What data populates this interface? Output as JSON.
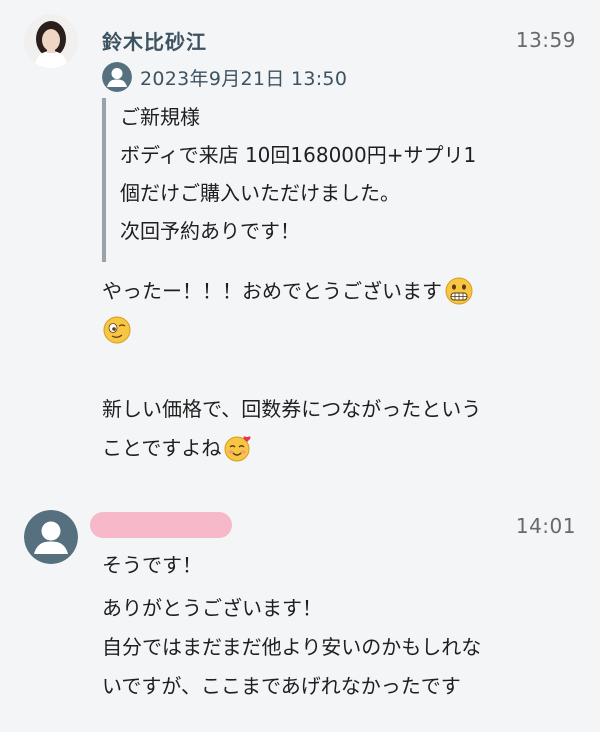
{
  "message1": {
    "sender": "鈴木比砂江",
    "time": "13:59",
    "avatar_icon": "profile-photo",
    "quote": {
      "icon": "default-user-icon",
      "timestamp": "2023年9月21日 13:50",
      "lines": [
        "ご新規様",
        "ボディで来店 10回168000円+サプリ1",
        "個だけご購入いただけました。",
        "次回予約ありです！"
      ]
    },
    "body": {
      "line1": "やったー！！！おめでとうございます",
      "line3": "新しい価格で、回数券につながったという",
      "line4": "ことですよね"
    },
    "emojis": [
      "grimacing-face-emoji",
      "saluting-face-emoji",
      "smiling-face-with-hearts-emoji"
    ]
  },
  "message2": {
    "sender": "",
    "sender_redacted": true,
    "time": "14:01",
    "avatar_icon": "default-user-icon",
    "lines": [
      "そうです！",
      "ありがとうございます！",
      "自分ではまだまだ他より安いのかもしれな",
      "いですが、ここまであげれなかったです"
    ]
  },
  "colors": {
    "background": "#f4f5f7",
    "sender_name": "#3d5361",
    "quote_bar": "#9aa3ab",
    "default_avatar": "#56707f",
    "redaction": "#f7b9c9"
  }
}
